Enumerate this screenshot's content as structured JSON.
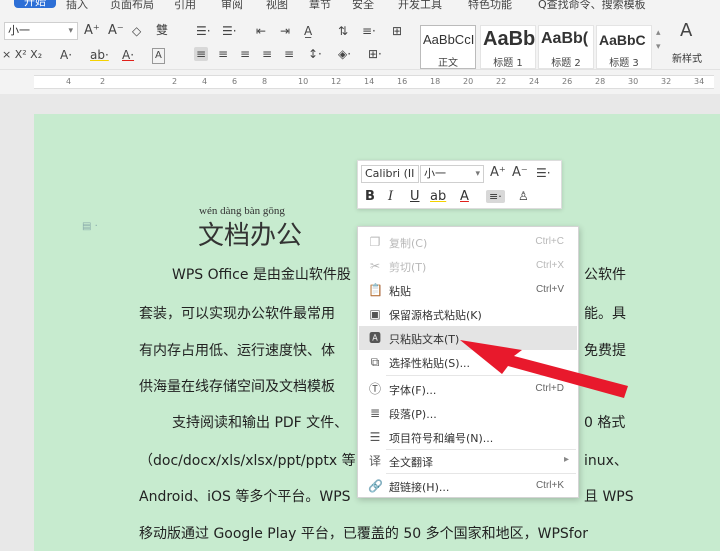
{
  "menubar": {
    "items": [
      "开始",
      "插入",
      "页面布局",
      "引用",
      "审阅",
      "视图",
      "章节",
      "安全",
      "开发工具",
      "特色功能"
    ],
    "search": "Q查找命令、搜索模板"
  },
  "ribbon": {
    "font_size": "小一",
    "grow_font": "A⁺",
    "shrink_font": "A⁻",
    "styles": [
      {
        "sample": "AaBbCcI",
        "name": "正文"
      },
      {
        "sample": "AaBb",
        "name": "标题 1"
      },
      {
        "sample": "AaBb(",
        "name": "标题 2"
      },
      {
        "sample": "AaBbC",
        "name": "标题 3"
      }
    ],
    "new_style_label": "新样式"
  },
  "ruler": {
    "numbers": [
      "4",
      "2",
      "2",
      "4",
      "6",
      "8",
      "10",
      "12",
      "14",
      "16",
      "18",
      "20",
      "22",
      "24",
      "26",
      "28",
      "30",
      "32",
      "34"
    ]
  },
  "document": {
    "pinyin": "wén dàng bàn gōng",
    "title": "文档办公",
    "lines": [
      "WPS Office 是由金山软件股",
      "套装，可以实现办公软件最常用",
      "有内存占用低、运行速度快、体",
      "供海量在线存储空间及文档模板",
      "支持阅读和输出 PDF 文件、",
      "（doc/docx/xls/xlsx/ppt/pptx 等",
      "Android、iOS 等多个平台。WPS",
      "移动版通过 Google Play 平台，已覆盖的 50 多个国家和地区，WPSfor"
    ],
    "right_fragments": [
      "公软件",
      "能。具",
      "免费提",
      "0 格式",
      "inux、",
      "且 WPS"
    ]
  },
  "mini_toolbar": {
    "font_name": "Calibri (II",
    "font_size": "小一",
    "grow": "A⁺",
    "shrink": "A⁻",
    "bold": "B",
    "italic": "I",
    "underline": "U",
    "highlight": "ab",
    "font_color": "A"
  },
  "context_menu": {
    "items": [
      {
        "label": "复制(C)",
        "shortcut": "Ctrl+C",
        "icon": "copy-icon",
        "disabled": true
      },
      {
        "label": "剪切(T)",
        "shortcut": "Ctrl+X",
        "icon": "scissors-icon",
        "disabled": true
      },
      {
        "label": "粘贴",
        "shortcut": "Ctrl+V",
        "icon": "paste-icon",
        "disabled": false
      },
      {
        "label": "保留源格式粘贴(K)",
        "shortcut": "",
        "icon": "paste-keep-format-icon",
        "disabled": false
      },
      {
        "label": "只粘贴文本(T)",
        "shortcut": "",
        "icon": "paste-text-only-icon",
        "disabled": false,
        "highlighted": true
      },
      {
        "label": "选择性粘贴(S)...",
        "shortcut": "",
        "icon": "paste-special-icon",
        "disabled": false
      },
      {
        "label": "字体(F)...",
        "shortcut": "Ctrl+D",
        "icon": "font-icon",
        "disabled": false
      },
      {
        "label": "段落(P)...",
        "shortcut": "",
        "icon": "paragraph-icon",
        "disabled": false
      },
      {
        "label": "项目符号和编号(N)...",
        "shortcut": "",
        "icon": "bullets-icon",
        "disabled": false
      },
      {
        "label": "全文翻译",
        "shortcut": "",
        "icon": "translate-icon",
        "disabled": false,
        "submenu": true
      },
      {
        "label": "超链接(H)...",
        "shortcut": "Ctrl+K",
        "icon": "link-icon",
        "disabled": false
      }
    ]
  },
  "colors": {
    "page_background": "#c7ebcf",
    "accent_tab": "#2d6fd6",
    "arrow": "#e8192c"
  }
}
